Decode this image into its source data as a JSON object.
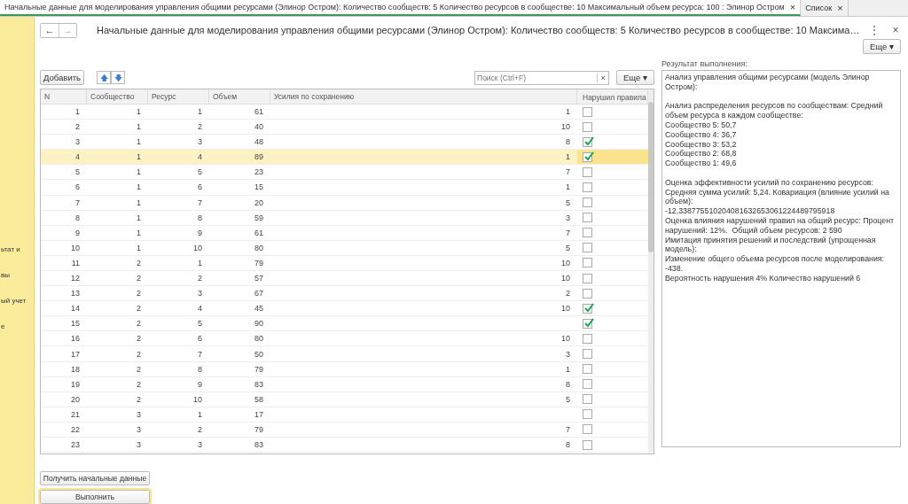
{
  "tabs": [
    {
      "label": "Начальные данные для моделирования управления общими ресурсами (Элинор Остром):  Количество сообществ: 5 Количество ресурсов в сообществе: 10 Максимальный объем ресурса: 100  : Элинор Остром",
      "close": "×",
      "selected": true
    },
    {
      "label": "Список",
      "close": "×",
      "selected": false
    }
  ],
  "sidebar": {
    "items": [
      "ьтат и",
      "вы",
      "ый учет",
      "е"
    ]
  },
  "nav": {
    "back": "←",
    "forward": "→"
  },
  "title": "Начальные данные для моделирования управления общими ресурсами (Элинор Остром): Количество сообществ: 5 Количество ресурсов в сообществе: 10 Максима…",
  "menu_icon": "⋮",
  "close_icon": "×",
  "more_button": "Еще ▾",
  "toolbar": {
    "add": "Добавить",
    "up": "🡅",
    "down": "🡇",
    "search_placeholder": "Поиск (Ctrl+F)",
    "search_clear": "×",
    "more": "Еще ▾"
  },
  "table": {
    "columns": [
      "N",
      "Сообщество",
      "Ресурс",
      "Объем",
      "Усилия по сохранению",
      "Нарушил правила"
    ],
    "rows": [
      {
        "n": "1",
        "community": "1",
        "resource": "1",
        "volume": "61",
        "effort": "1",
        "violated": false,
        "selected": false
      },
      {
        "n": "2",
        "community": "1",
        "resource": "2",
        "volume": "40",
        "effort": "10",
        "violated": false,
        "selected": false
      },
      {
        "n": "3",
        "community": "1",
        "resource": "3",
        "volume": "48",
        "effort": "8",
        "violated": true,
        "selected": false
      },
      {
        "n": "4",
        "community": "1",
        "resource": "4",
        "volume": "89",
        "effort": "1",
        "violated": true,
        "selected": true
      },
      {
        "n": "5",
        "community": "1",
        "resource": "5",
        "volume": "23",
        "effort": "7",
        "violated": false,
        "selected": false
      },
      {
        "n": "6",
        "community": "1",
        "resource": "6",
        "volume": "15",
        "effort": "1",
        "violated": false,
        "selected": false
      },
      {
        "n": "7",
        "community": "1",
        "resource": "7",
        "volume": "20",
        "effort": "5",
        "violated": false,
        "selected": false
      },
      {
        "n": "8",
        "community": "1",
        "resource": "8",
        "volume": "59",
        "effort": "3",
        "violated": false,
        "selected": false
      },
      {
        "n": "9",
        "community": "1",
        "resource": "9",
        "volume": "61",
        "effort": "7",
        "violated": false,
        "selected": false
      },
      {
        "n": "10",
        "community": "1",
        "resource": "10",
        "volume": "80",
        "effort": "5",
        "violated": false,
        "selected": false
      },
      {
        "n": "11",
        "community": "2",
        "resource": "1",
        "volume": "79",
        "effort": "10",
        "violated": false,
        "selected": false
      },
      {
        "n": "12",
        "community": "2",
        "resource": "2",
        "volume": "57",
        "effort": "10",
        "violated": false,
        "selected": false
      },
      {
        "n": "13",
        "community": "2",
        "resource": "3",
        "volume": "67",
        "effort": "2",
        "violated": false,
        "selected": false
      },
      {
        "n": "14",
        "community": "2",
        "resource": "4",
        "volume": "45",
        "effort": "10",
        "violated": true,
        "selected": false
      },
      {
        "n": "15",
        "community": "2",
        "resource": "5",
        "volume": "90",
        "violated": true,
        "selected": false
      },
      {
        "n": "16",
        "community": "2",
        "resource": "6",
        "volume": "80",
        "effort": "10",
        "violated": false,
        "selected": false
      },
      {
        "n": "17",
        "community": "2",
        "resource": "7",
        "volume": "50",
        "effort": "3",
        "violated": false,
        "selected": false
      },
      {
        "n": "18",
        "community": "2",
        "resource": "8",
        "volume": "79",
        "effort": "1",
        "violated": false,
        "selected": false
      },
      {
        "n": "19",
        "community": "2",
        "resource": "9",
        "volume": "83",
        "effort": "8",
        "violated": false,
        "selected": false
      },
      {
        "n": "20",
        "community": "2",
        "resource": "10",
        "volume": "58",
        "effort": "5",
        "violated": false,
        "selected": false
      },
      {
        "n": "21",
        "community": "3",
        "resource": "1",
        "volume": "17",
        "violated": false,
        "selected": false
      },
      {
        "n": "22",
        "community": "3",
        "resource": "2",
        "volume": "79",
        "effort": "7",
        "violated": false,
        "selected": false
      },
      {
        "n": "23",
        "community": "3",
        "resource": "3",
        "volume": "83",
        "effort": "8",
        "violated": false,
        "selected": false
      }
    ]
  },
  "buttons": [
    "Получить начальные данные",
    "Выполнить"
  ],
  "result": {
    "label": "Результат выполнения:",
    "text": "Анализ управления общими ресурсами (модель Элинор Остром):\n\nАнализ распределения ресурсов по сообществам: Средний объем ресурса в каждом сообществе:\nСообщество 5: 50,7\nСообщество 4: 36,7\nСообщество 3: 53,2\nСообщество 2: 68,8\nСообщество 1: 49,6\n\nОценка эффективности усилий по сохранению ресурсов: Средняя сумма усилий: 5,24. Ковариация (влияние усилий на объем):\n-12,338775510204081632653061224489795918\nОценка влияния нарушений правил на общий ресурс: Процент нарушений: 12%.  Общий объем ресурсов: 2 590\nИмитация принятия решений и последствий (упрощенная модель):\nИзменение общего объема ресурсов после моделирования: -438.\nВероятность нарушения 4% Количество нарушений 6"
  }
}
